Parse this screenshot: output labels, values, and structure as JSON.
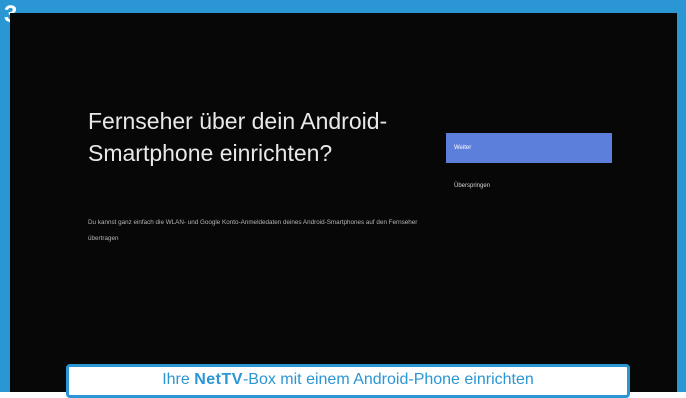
{
  "step_number": "3",
  "screen": {
    "title": "Fernseher über dein Android-Smartphone einrichten?",
    "description": "Du kannst ganz einfach die WLAN- und Google Konto-Anmeldedaten deines Android-Smartphones auf den Fernseher übertragen",
    "options": {
      "continue_label": "Weiter",
      "skip_label": "Überspringen"
    }
  },
  "caption": {
    "prefix": "Ihre ",
    "brand": "NetTV",
    "suffix": "-Box mit einem Android-Phone einrichten"
  },
  "colors": {
    "accent": "#2a96d4",
    "focus": "#5d7fdc",
    "screen_bg": "#070707"
  }
}
